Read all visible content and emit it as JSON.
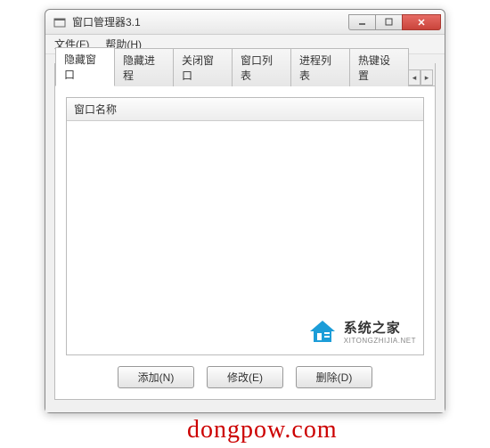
{
  "window": {
    "title": "窗口管理器3.1"
  },
  "menubar": {
    "file": "文件(F)",
    "help": "帮助(H)"
  },
  "tabs": [
    {
      "label": "隐藏窗口",
      "active": true
    },
    {
      "label": "隐藏进程",
      "active": false
    },
    {
      "label": "关闭窗口",
      "active": false
    },
    {
      "label": "窗口列表",
      "active": false
    },
    {
      "label": "进程列表",
      "active": false
    },
    {
      "label": "热键设置",
      "active": false
    }
  ],
  "list": {
    "column_header": "窗口名称"
  },
  "buttons": {
    "add": "添加(N)",
    "edit": "修改(E)",
    "delete": "删除(D)"
  },
  "watermark": {
    "cn": "系统之家",
    "en": "XITONGZHIJIA.NET"
  },
  "footer": "dongpow.com"
}
